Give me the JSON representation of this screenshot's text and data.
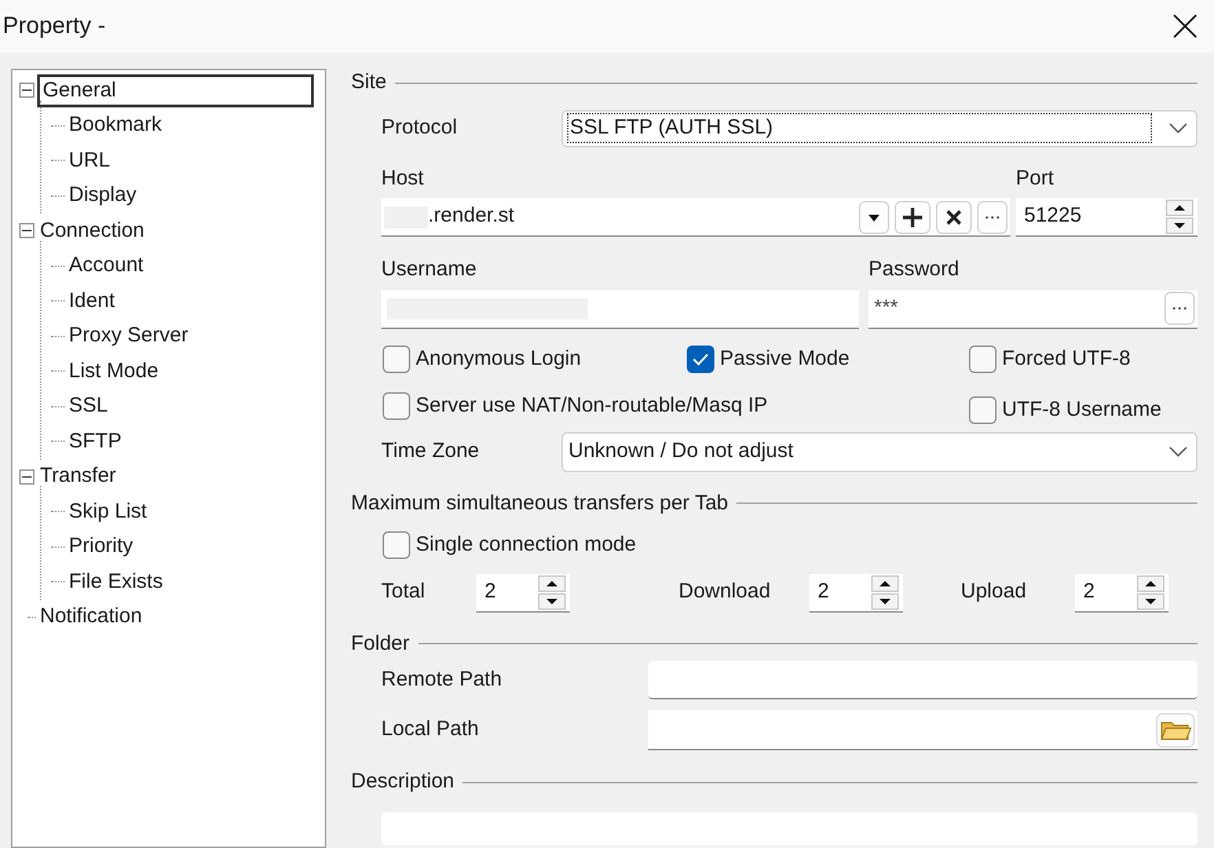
{
  "window": {
    "title": "Property -"
  },
  "tree": [
    {
      "label": "General",
      "expanded": true,
      "selected": true,
      "children": [
        {
          "label": "Bookmark",
          "selected": false
        },
        {
          "label": "URL",
          "selected": false
        },
        {
          "label": "Display",
          "selected": false
        }
      ]
    },
    {
      "label": "Connection",
      "expanded": true,
      "selected": false,
      "children": [
        {
          "label": "Account",
          "selected": false
        },
        {
          "label": "Ident",
          "selected": false
        },
        {
          "label": "Proxy Server",
          "selected": false
        },
        {
          "label": "List Mode",
          "selected": false
        },
        {
          "label": "SSL",
          "selected": false
        },
        {
          "label": "SFTP",
          "selected": false
        }
      ]
    },
    {
      "label": "Transfer",
      "expanded": true,
      "selected": false,
      "children": [
        {
          "label": "Skip List",
          "selected": false
        },
        {
          "label": "Priority",
          "selected": false
        },
        {
          "label": "File Exists",
          "selected": false
        }
      ]
    },
    {
      "label": "Notification",
      "selected": false
    }
  ],
  "site": {
    "heading": "Site",
    "protocol": {
      "label": "Protocol",
      "value": "SSL FTP (AUTH SSL)"
    },
    "host": {
      "label": "Host",
      "value": ".render.st"
    },
    "port": {
      "label": "Port",
      "value": "51225"
    },
    "username": {
      "label": "Username"
    },
    "password": {
      "label": "Password",
      "value": "***"
    },
    "options": [
      {
        "label": "Anonymous Login",
        "checked": false
      },
      {
        "label": "Passive Mode",
        "checked": true
      },
      {
        "label": "Forced UTF-8",
        "checked": false
      },
      {
        "label": "Server use NAT/Non-routable/Masq IP",
        "checked": false
      },
      {
        "label": "UTF-8 Username",
        "checked": false
      }
    ],
    "time_zone": {
      "label": "Time Zone",
      "value": "Unknown / Do not adjust"
    }
  },
  "transfers": {
    "heading": "Maximum simultaneous transfers per Tab",
    "single_connection": {
      "label": "Single connection mode",
      "checked": false
    },
    "limits": [
      {
        "label": "Total",
        "value": "2"
      },
      {
        "label": "Download",
        "value": "2"
      },
      {
        "label": "Upload",
        "value": "2"
      }
    ]
  },
  "folder": {
    "heading": "Folder",
    "remote_path": {
      "label": "Remote Path"
    },
    "local_path": {
      "label": "Local Path"
    }
  },
  "description": {
    "heading": "Description"
  }
}
